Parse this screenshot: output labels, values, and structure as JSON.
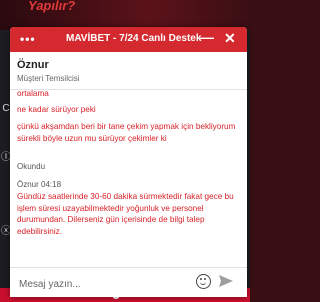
{
  "background": {
    "title": "Yapılır?",
    "side_icons": [
      "C",
      "Ⓘ",
      "ⓧ"
    ]
  },
  "chat": {
    "header": {
      "title": "MAVİBET - 7/24 Canlı Destek",
      "menu_icon": "more-dots-icon",
      "minimize_icon": "minimize-icon",
      "close_icon": "close-icon"
    },
    "agent": {
      "name": "Öznur",
      "role": "Müşteri Temsilcisi"
    },
    "messages": [
      {
        "text": "ortalama"
      },
      {
        "text": "ne kadar sürüyor peki"
      },
      {
        "text": "çünkü akşamdan beri bir tane çekim yapmak için bekliyorum sürekli böyle uzun mu sürüyor çekimler ki"
      },
      {
        "status": "Okundu"
      },
      {
        "sender": "Öznur 04:18"
      },
      {
        "text": "Gündüz saatlerinde 30-60 dakika sürmektedir fakat gece bu işlem süresi uzayabilmektedir yoğunluk ve personel durumundan. Dilerseniz gün içerisinde de bilgi talep edebilirsiniz."
      }
    ],
    "composer": {
      "placeholder": "Mesaj yazın...",
      "emoji_icon": "emoji-icon",
      "send_icon": "send-icon"
    },
    "colors": {
      "header": "#d42a2f",
      "message_text": "#d81f26"
    }
  }
}
